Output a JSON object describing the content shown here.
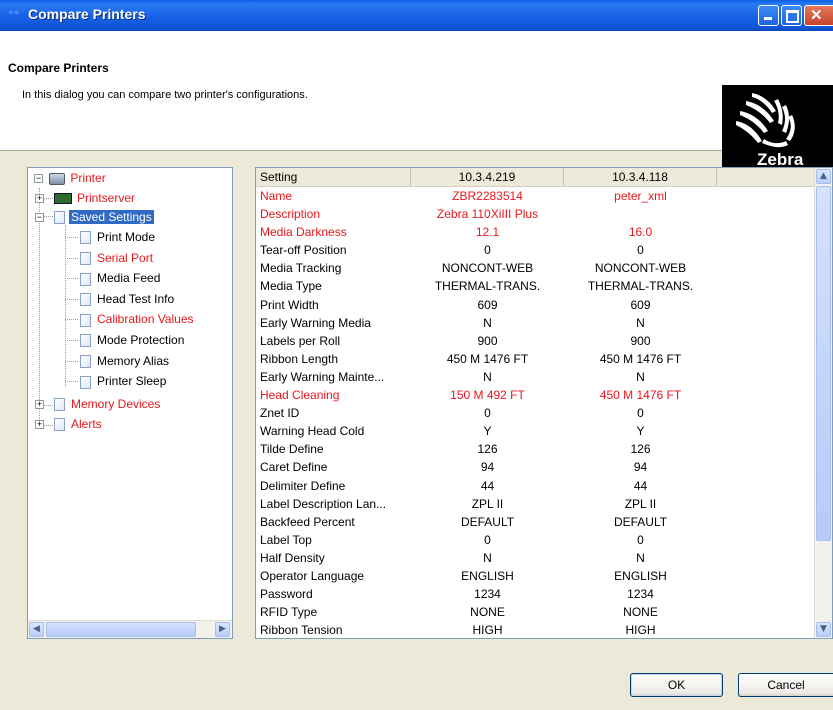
{
  "window": {
    "title": "Compare Printers",
    "controls": {
      "minimize": "minimize",
      "maximize": "maximize",
      "close": "close"
    }
  },
  "header": {
    "title": "Compare Printers",
    "description": "In this dialog you can compare two printer's configurations.",
    "logo_text": "Zebra"
  },
  "tree": {
    "root": "Printer",
    "printserver": "Printserver",
    "saved_settings": "Saved Settings",
    "children": [
      {
        "label": "Print Mode",
        "red": false
      },
      {
        "label": "Serial Port",
        "red": true
      },
      {
        "label": "Media Feed",
        "red": false
      },
      {
        "label": "Head Test Info",
        "red": false
      },
      {
        "label": "Calibration Values",
        "red": true
      },
      {
        "label": "Mode Protection",
        "red": false
      },
      {
        "label": "Memory Alias",
        "red": false
      },
      {
        "label": "Printer Sleep",
        "red": false
      }
    ],
    "memory_devices": "Memory Devices",
    "alerts": "Alerts"
  },
  "table": {
    "columns": [
      "Setting",
      "10.3.4.219",
      "10.3.4.118",
      ""
    ],
    "rows": [
      {
        "setting": "Name",
        "a": "ZBR2283514",
        "b": "peter_xml",
        "diff": true
      },
      {
        "setting": "Description",
        "a": "Zebra 110XiIII Plus",
        "b": "",
        "diff": true
      },
      {
        "setting": "Media Darkness",
        "a": "12.1",
        "b": "16.0",
        "diff": true
      },
      {
        "setting": "Tear-off Position",
        "a": "0",
        "b": "0",
        "diff": false
      },
      {
        "setting": "Media Tracking",
        "a": "NONCONT-WEB",
        "b": "NONCONT-WEB",
        "diff": false
      },
      {
        "setting": "Media Type",
        "a": "THERMAL-TRANS.",
        "b": "THERMAL-TRANS.",
        "diff": false
      },
      {
        "setting": "Print Width",
        "a": "609",
        "b": "609",
        "diff": false
      },
      {
        "setting": "Early Warning Media",
        "a": "N",
        "b": "N",
        "diff": false
      },
      {
        "setting": "Labels per Roll",
        "a": "900",
        "b": "900",
        "diff": false
      },
      {
        "setting": "Ribbon Length",
        "a": "450 M  1476 FT",
        "b": "450 M  1476 FT",
        "diff": false
      },
      {
        "setting": "Early Warning Mainte...",
        "a": "N",
        "b": "N",
        "diff": false
      },
      {
        "setting": "Head Cleaning",
        "a": "150 M  492 FT",
        "b": "450 M  1476 FT",
        "diff": true
      },
      {
        "setting": "Znet ID",
        "a": "0",
        "b": "0",
        "diff": false
      },
      {
        "setting": "Warning Head Cold",
        "a": "Y",
        "b": "Y",
        "diff": false
      },
      {
        "setting": "Tilde Define",
        "a": "126",
        "b": "126",
        "diff": false
      },
      {
        "setting": "Caret Define",
        "a": "94",
        "b": "94",
        "diff": false
      },
      {
        "setting": "Delimiter Define",
        "a": "44",
        "b": "44",
        "diff": false
      },
      {
        "setting": "Label Description Lan...",
        "a": "ZPL II",
        "b": "ZPL II",
        "diff": false
      },
      {
        "setting": "Backfeed Percent",
        "a": "DEFAULT",
        "b": "DEFAULT",
        "diff": false
      },
      {
        "setting": "Label Top",
        "a": "0",
        "b": "0",
        "diff": false
      },
      {
        "setting": "Half Density",
        "a": "N",
        "b": "N",
        "diff": false
      },
      {
        "setting": "Operator Language",
        "a": "ENGLISH",
        "b": "ENGLISH",
        "diff": false
      },
      {
        "setting": "Password",
        "a": "1234",
        "b": "1234",
        "diff": false
      },
      {
        "setting": "RFID Type",
        "a": "NONE",
        "b": "NONE",
        "diff": false
      },
      {
        "setting": "Ribbon Tension",
        "a": "HIGH",
        "b": "HIGH",
        "diff": false
      }
    ]
  },
  "buttons": {
    "ok": "OK",
    "cancel": "Cancel"
  },
  "colors": {
    "diff": "#e8171c",
    "selection": "#316ac5",
    "titlebar": "#0a5ee6"
  }
}
